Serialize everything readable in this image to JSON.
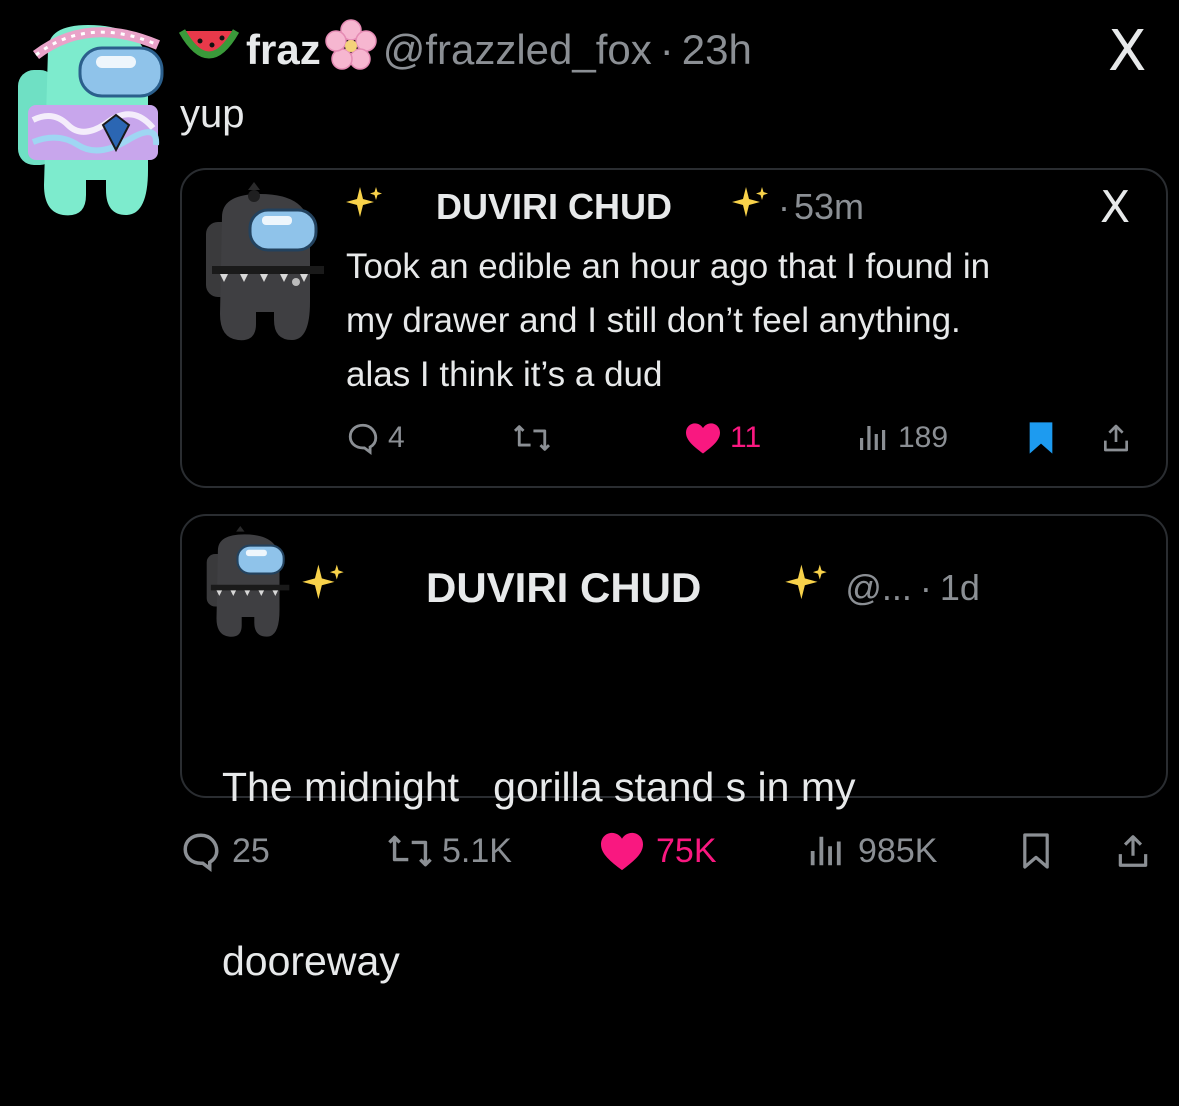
{
  "main_tweet": {
    "display_name": "fraz",
    "handle": "@frazzled_fox",
    "separator": "·",
    "time": "23h",
    "text": "yup",
    "name_emoji_left": "watermelon-icon",
    "name_emoji_right": "cherry-blossom-icon",
    "stats": {
      "replies": "25",
      "reposts": "5.1K",
      "likes": "75K",
      "views": "985K"
    }
  },
  "quote_1": {
    "display_name": "DUVIRI CHUD",
    "separator": "·",
    "time": "53m",
    "text_lines": [
      "Took an edible an hour ago that I found in",
      "my drawer and I still don’t feel anything.",
      "alas I think it’s a dud"
    ],
    "stats": {
      "replies": "4",
      "likes": "11",
      "views": "189"
    }
  },
  "quote_2": {
    "display_name": "DUVIRI CHUD",
    "handle": "@...",
    "separator": "·",
    "time": "1d",
    "text_lines": [
      "The midnight   gorilla stand s in my",
      "dooreway"
    ]
  },
  "colors": {
    "background": "#000000",
    "text": "#e7e9ea",
    "muted": "#8b8f94",
    "like": "#f91880",
    "bookmark": "#1d9bf0",
    "border": "#2a2d31"
  },
  "x_logo": "X"
}
